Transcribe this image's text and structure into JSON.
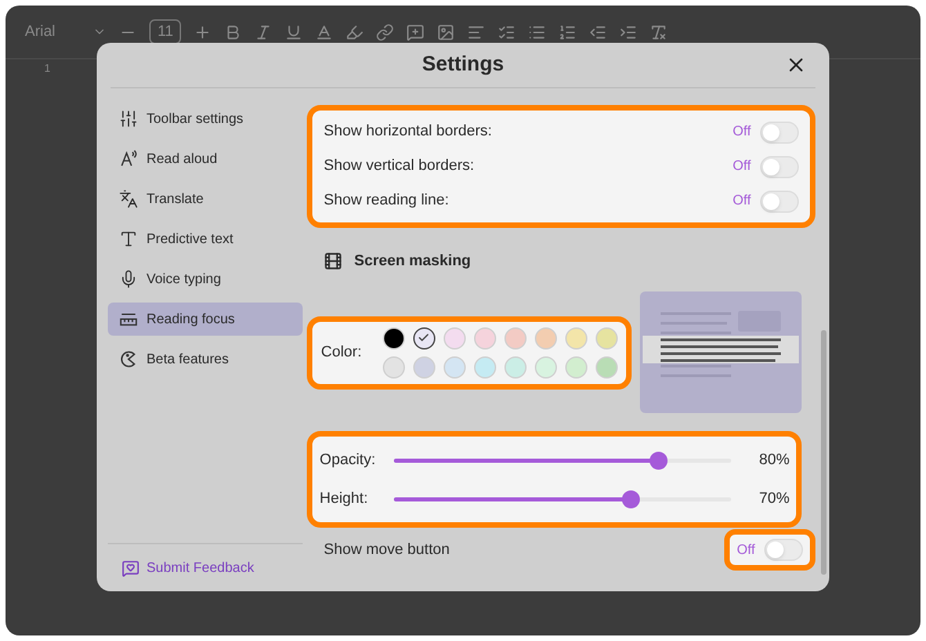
{
  "editor_toolbar": {
    "font": "Arial",
    "font_size": "11"
  },
  "ruler": {
    "mark": "1"
  },
  "dialog": {
    "title": "Settings"
  },
  "sidebar": {
    "items": [
      {
        "kind": "toolbar",
        "label": "Toolbar settings",
        "selected": false
      },
      {
        "kind": "read",
        "label": "Read aloud",
        "selected": false
      },
      {
        "kind": "translate",
        "label": "Translate",
        "selected": false
      },
      {
        "kind": "predict",
        "label": "Predictive text",
        "selected": false
      },
      {
        "kind": "voice",
        "label": "Voice typing",
        "selected": false
      },
      {
        "kind": "focus",
        "label": "Reading focus",
        "selected": true
      },
      {
        "kind": "beta",
        "label": "Beta features",
        "selected": false
      }
    ],
    "feedback": "Submit Feedback"
  },
  "toggle_group": {
    "highlighted": true,
    "rows": [
      {
        "label": "Show horizontal borders:",
        "state_text": "Off",
        "on": false
      },
      {
        "label": "Show vertical borders:",
        "state_text": "Off",
        "on": false
      },
      {
        "label": "Show reading line:",
        "state_text": "Off",
        "on": false
      }
    ]
  },
  "screen_masking": {
    "title": "Screen masking"
  },
  "color_picker": {
    "highlighted": true,
    "label": "Color:",
    "swatches": [
      {
        "color": "#000000",
        "selected": false
      },
      {
        "color": "#e8e6f4",
        "selected": true
      },
      {
        "color": "#f3dcef",
        "selected": false
      },
      {
        "color": "#f5d3dc",
        "selected": false
      },
      {
        "color": "#f3cbc4",
        "selected": false
      },
      {
        "color": "#f3cdb0",
        "selected": false
      },
      {
        "color": "#f3e5a9",
        "selected": false
      },
      {
        "color": "#e6e3a0",
        "selected": false
      },
      {
        "color": "#e3e3e3",
        "selected": false
      },
      {
        "color": "#cfd2e3",
        "selected": false
      },
      {
        "color": "#d4e5f3",
        "selected": false
      },
      {
        "color": "#c5ebf3",
        "selected": false
      },
      {
        "color": "#cbeee6",
        "selected": false
      },
      {
        "color": "#d8f3e0",
        "selected": false
      },
      {
        "color": "#d2eecf",
        "selected": false
      },
      {
        "color": "#b9ddb5",
        "selected": false
      }
    ]
  },
  "sliders": {
    "highlighted": true,
    "rows": [
      {
        "label": "Opacity:",
        "level": 0.78,
        "reading": "80%"
      },
      {
        "label": "Height:",
        "level": 0.7,
        "reading": "70%"
      }
    ]
  },
  "move_button": {
    "label": "Show move button",
    "state_text": "Off",
    "on": false,
    "highlighted": true
  }
}
